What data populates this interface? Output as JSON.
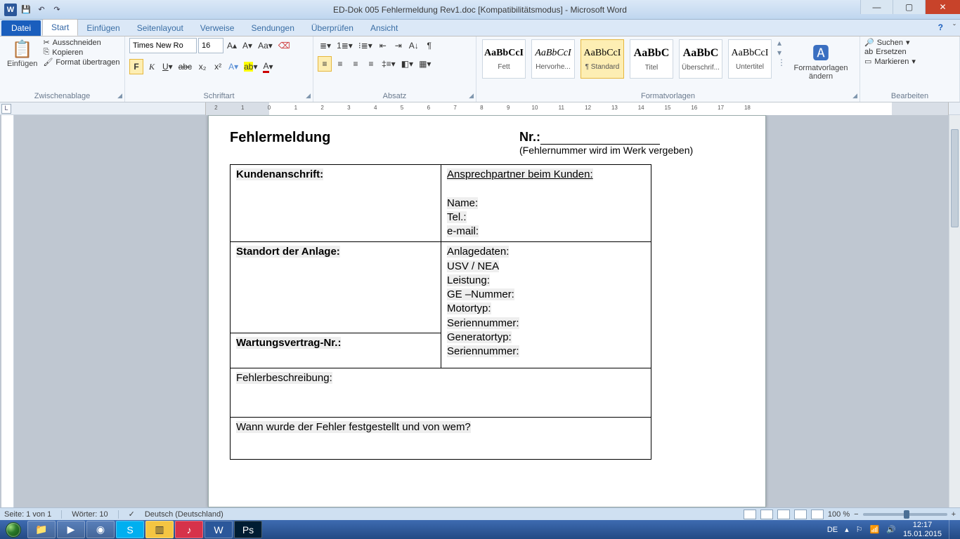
{
  "title": "ED-Dok 005 Fehlermeldung Rev1.doc [Kompatibilitätsmodus] - Microsoft Word",
  "tabs": {
    "file": "Datei",
    "start": "Start",
    "insert": "Einfügen",
    "layout": "Seitenlayout",
    "ref": "Verweise",
    "mail": "Sendungen",
    "review": "Überprüfen",
    "view": "Ansicht"
  },
  "clipboard": {
    "cut": "Ausschneiden",
    "copy": "Kopieren",
    "fmt": "Format übertragen",
    "paste": "Einfügen",
    "group": "Zwischenablage"
  },
  "font": {
    "name": "Times New Ro",
    "size": "16",
    "group": "Schriftart"
  },
  "paragraph": {
    "group": "Absatz"
  },
  "styles": {
    "group": "Formatvorlagen",
    "change": "Formatvorlagen ändern",
    "sample": "AaBbCcI",
    "sample_big": "AaBbC",
    "s1": "Fett",
    "s2": "Hervorhe...",
    "s3": "¶ Standard",
    "s4": "Titel",
    "s5": "Überschrif...",
    "s6": "Untertitel"
  },
  "editing": {
    "group": "Bearbeiten",
    "find": "Suchen",
    "replace": "Ersetzen",
    "select": "Markieren"
  },
  "status": {
    "page": "Seite: 1 von 1",
    "words": "Wörter: 10",
    "lang": "Deutsch (Deutschland)",
    "zoom": "100 %"
  },
  "doc": {
    "title": "Fehlermeldung",
    "nr": "Nr.:",
    "nr_note": "(Fehlernummer wird im Werk vergeben)",
    "r1a": "Kundenanschrift:",
    "r1b_h": "Ansprechpartner beim Kunden:",
    "r1b_1": "Name:",
    "r1b_2": "Tel.:",
    "r1b_3": "e-mail:",
    "r2a": "Standort der Anlage:",
    "r2b_h": "Anlagedaten:",
    "r2b_1": "USV / NEA",
    "r2b_2": "Leistung:",
    "r2b_3": "GE –Nummer:",
    "r2b_4": "Motortyp:",
    "r2b_5": "Seriennummer:",
    "r2b_6": "Generatortyp:",
    "r2b_7": "Seriennummer:",
    "r3a": "Wartungsvertrag-Nr.:",
    "r4": "Fehlerbeschreibung:",
    "r5": "Wann wurde der Fehler festgestellt und von wem?"
  },
  "tray": {
    "lang": "DE",
    "time": "12:17",
    "date": "15.01.2015"
  }
}
